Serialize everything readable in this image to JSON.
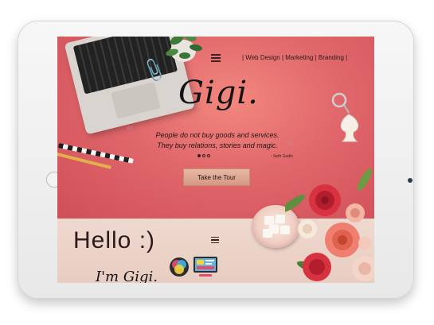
{
  "nav": {
    "links_text": "| Web Design | Marketing | Branding |"
  },
  "hero": {
    "logo": "Gigi.",
    "quote_line1": "People do not buy goods and services.",
    "quote_line2": "They buy relations, stories and magic.",
    "quote_author": "- Seth Godin",
    "cta_label": "Take the Tour",
    "slider_dots": 3,
    "active_dot": 0
  },
  "section2": {
    "heading": "Hello :)",
    "subheading": "I'm Gigi."
  },
  "colors": {
    "hero_center": "#f2877e",
    "hero_edge": "#cf4f58",
    "button_bg": "#e2a893",
    "text_dark": "#241616"
  },
  "icons": [
    "menu-icon",
    "paperclip-icon",
    "plant-icon",
    "keychain-icon",
    "color-wheel-icon",
    "design-screen-icon",
    "home-button-icon",
    "camera-icon"
  ]
}
